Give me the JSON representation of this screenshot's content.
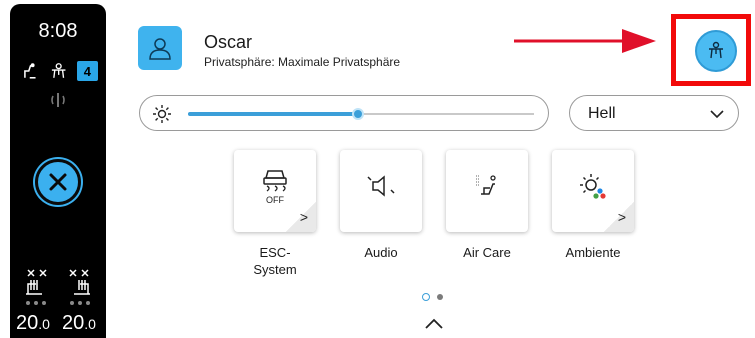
{
  "status_bar": {
    "time": "8:08",
    "badge_count": "4",
    "left_temp_main": "20",
    "left_temp_dec": ".0",
    "right_temp_main": "20",
    "right_temp_dec": ".0"
  },
  "profile": {
    "name": "Oscar",
    "privacy_label": "Privatsphäre: Maximale Privatsphäre"
  },
  "display": {
    "brightness_level": 0.49,
    "mode_selected": "Hell"
  },
  "quick_tiles": [
    {
      "label_line1": "ESC-",
      "label_line2": "System",
      "icon": "esc-off-icon",
      "has_submenu": true,
      "icon_text": "OFF"
    },
    {
      "label_line1": "Audio",
      "icon": "speaker-mute-icon",
      "has_submenu": false
    },
    {
      "label_line1": "Air Care",
      "icon": "air-care-icon",
      "has_submenu": false
    },
    {
      "label_line1": "Ambiente",
      "icon": "ambient-light-icon",
      "has_submenu": true
    }
  ],
  "pagination": {
    "current_page": 1,
    "total_pages": 2
  },
  "colors": {
    "accent": "#3b9fd9",
    "highlight": "#f20a0a",
    "arrow": "#e0102a",
    "profile_blue": "#3fb3ee"
  }
}
